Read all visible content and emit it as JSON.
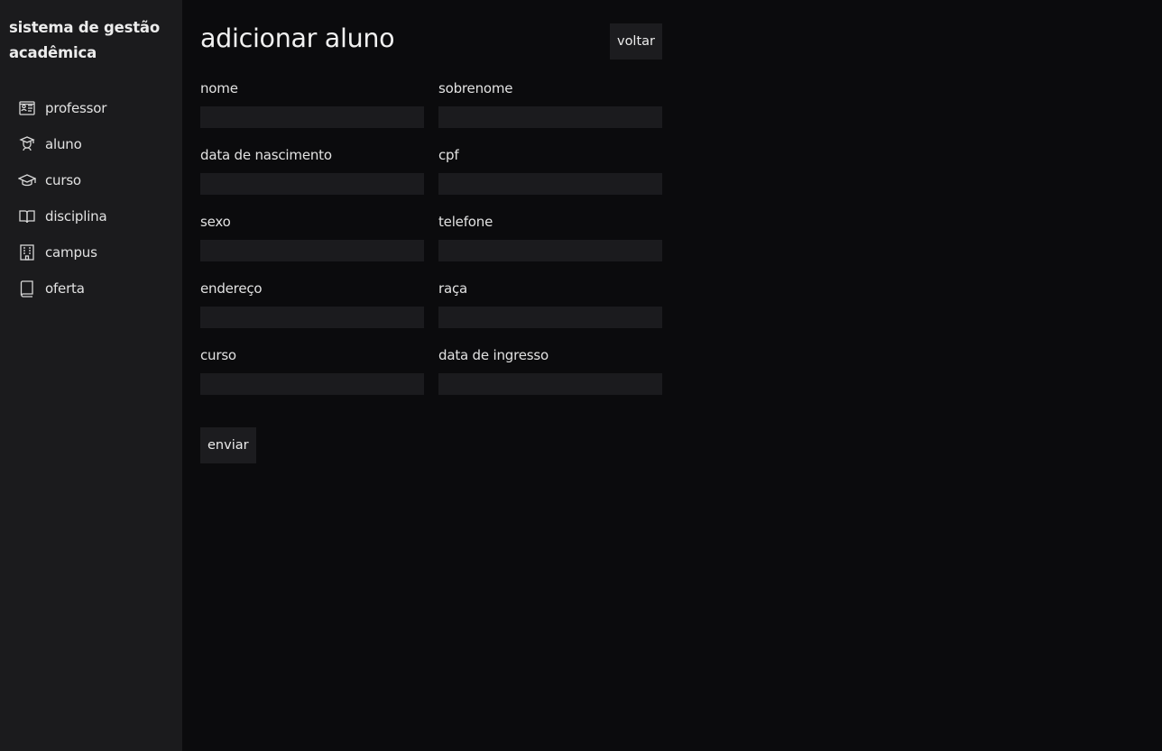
{
  "app": {
    "title": "sistema de gestão acadêmica"
  },
  "sidebar": {
    "items": [
      {
        "label": "professor",
        "icon": "id-card-icon"
      },
      {
        "label": "aluno",
        "icon": "student-icon"
      },
      {
        "label": "curso",
        "icon": "graduation-cap-icon"
      },
      {
        "label": "disciplina",
        "icon": "open-book-icon"
      },
      {
        "label": "campus",
        "icon": "building-icon"
      },
      {
        "label": "oferta",
        "icon": "book-icon"
      }
    ]
  },
  "main": {
    "title": "adicionar aluno",
    "back_label": "voltar",
    "submit_label": "enviar",
    "fields": [
      {
        "label": "nome",
        "value": ""
      },
      {
        "label": "sobrenome",
        "value": ""
      },
      {
        "label": "data de nascimento",
        "value": ""
      },
      {
        "label": "cpf",
        "value": ""
      },
      {
        "label": "sexo",
        "value": ""
      },
      {
        "label": "telefone",
        "value": ""
      },
      {
        "label": "endereço",
        "value": ""
      },
      {
        "label": "raça",
        "value": ""
      },
      {
        "label": "curso",
        "value": ""
      },
      {
        "label": "data de ingresso",
        "value": ""
      }
    ]
  },
  "colors": {
    "background": "#0b0b0d",
    "sidebar": "#1b1b1d",
    "input": "#1b1b1e",
    "text": "#e6e6e6"
  }
}
